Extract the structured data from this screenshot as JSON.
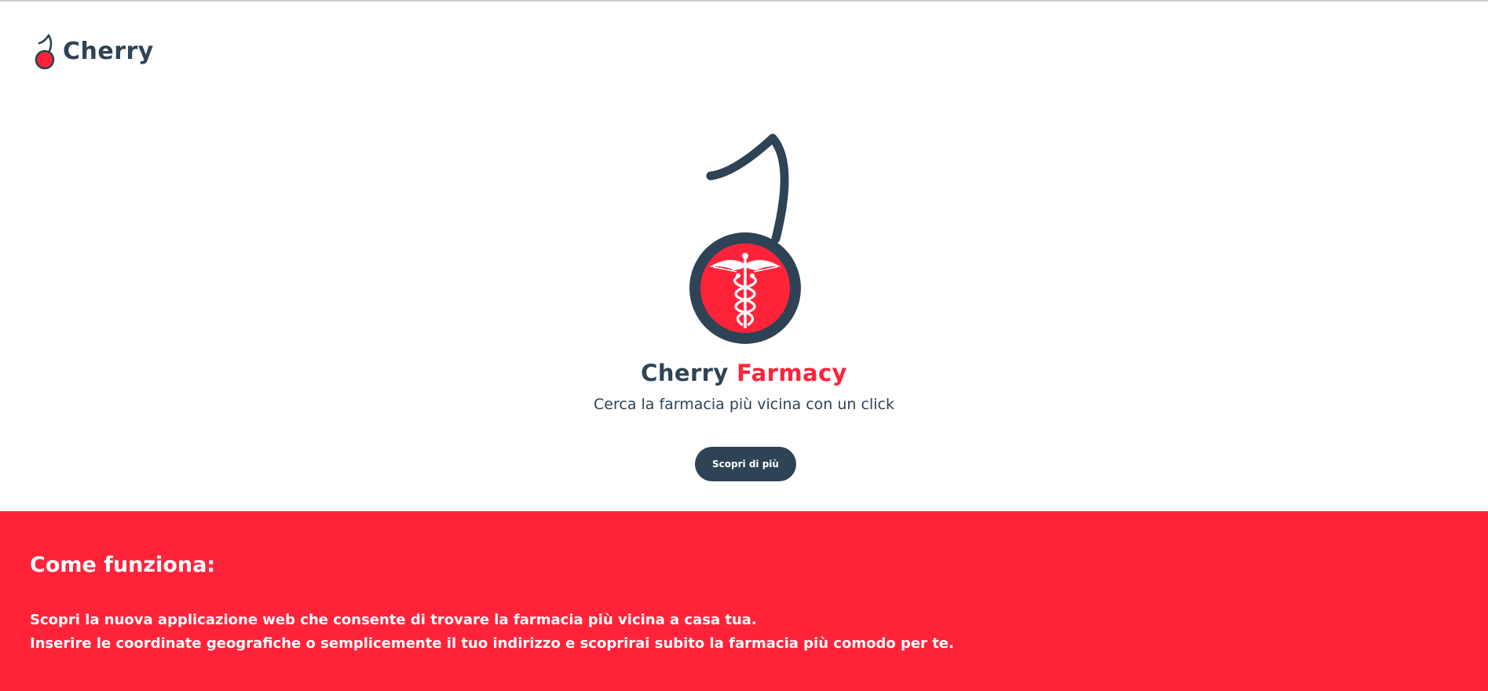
{
  "navbar": {
    "brand": "Cherry",
    "logo_icon": "cherry-icon"
  },
  "hero": {
    "logo_icon": "cherry-caduceus-icon",
    "title_part1": "Cherry",
    "title_part2": "Farmacy",
    "subtitle": "Cerca la farmacia più vicina con un click",
    "cta_label": "Scopri di più"
  },
  "how_it_works": {
    "title": "Come funziona:",
    "lines": [
      "Scopri la nuova applicazione web che consente di trovare la farmacia più vicina a casa tua.",
      "Inserire le coordinate geografiche o semplicemente il tuo indirizzo e scoprirai subito la farmacia più comodo per te."
    ]
  },
  "colors": {
    "brand_dark": "#2e4355",
    "brand_red": "#ff233a",
    "background": "#ffffff"
  }
}
